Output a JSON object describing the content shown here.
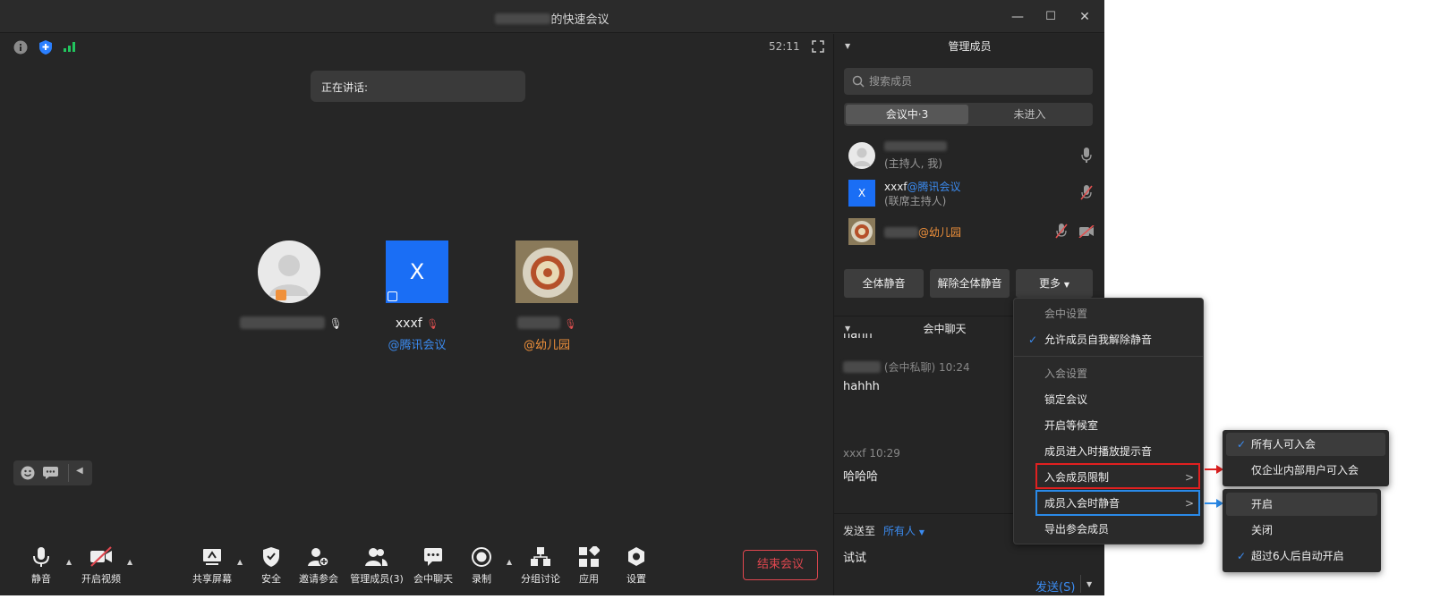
{
  "window": {
    "title_suffix": "的快速会议",
    "minimize": "—",
    "maximize": "☐",
    "close": "✕"
  },
  "meeting": {
    "timer": "52:11",
    "speaking_label": "正在讲话:",
    "participants": [
      {
        "name": "",
        "sub": "",
        "avatar": "person-icon"
      },
      {
        "name": "xxxf",
        "sub": "@腾讯会议",
        "avatar": "letter-x",
        "avatar_letter": "X",
        "avatar_color": "#1a6ef5",
        "sub_color": "#3b8bf0"
      },
      {
        "name": "",
        "sub": "@幼儿园",
        "avatar": "photo-plate",
        "sub_color": "#f0913b"
      }
    ]
  },
  "toolbar": {
    "mute": "静音",
    "video": "开启视频",
    "share": "共享屏幕",
    "security": "安全",
    "invite": "邀请参会",
    "members": "管理成员(3)",
    "chat": "会中聊天",
    "record": "录制",
    "breakout": "分组讨论",
    "apps": "应用",
    "settings": "设置",
    "end": "结束会议"
  },
  "sidebar": {
    "members_title": "管理成员",
    "search_placeholder": "搜索成员",
    "tab_in": "会议中·3",
    "tab_out": "未进入",
    "members": [
      {
        "name": "",
        "role": "(主持人, 我)"
      },
      {
        "name": "xxxf",
        "org": "@腾讯会议",
        "role": "(联席主持人)",
        "avatar_letter": "X"
      },
      {
        "name": "",
        "org": "@幼儿园",
        "role": ""
      }
    ],
    "btn_mute_all": "全体静音",
    "btn_unmute_all": "解除全体静音",
    "btn_more": "更多",
    "chat_title": "会中聊天",
    "chat": [
      {
        "text": "hahh"
      },
      {
        "meta": "(会中私聊) 10:24",
        "text": "hahhh"
      },
      {
        "meta": "xxxf 10:29",
        "text": "哈哈哈"
      }
    ],
    "send_to_label": "发送至",
    "send_to_value": "所有人",
    "draft": "试试",
    "send_btn": "发送(S)"
  },
  "more_menu": {
    "h1": "会中设置",
    "allow_unmute": "允许成员自我解除静音",
    "h2": "入会设置",
    "lock": "锁定会议",
    "waiting_room": "开启等候室",
    "join_sound": "成员进入时播放提示音",
    "join_restrict": "入会成员限制",
    "mute_on_join": "成员入会时静音",
    "export": "导出参会成员"
  },
  "submenu_restrict": {
    "opt1": "所有人可入会",
    "opt2": "仅企业内部用户可入会"
  },
  "submenu_mute": {
    "opt1": "开启",
    "opt2": "关闭",
    "opt3": "超过6人后自动开启"
  },
  "colors": {
    "accent": "#3b8bf0",
    "danger": "#e0474f",
    "org_orange": "#f0913b"
  }
}
